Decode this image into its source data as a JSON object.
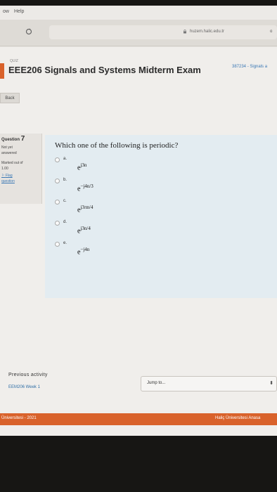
{
  "menubar": {
    "items": [
      "ow",
      "Help"
    ]
  },
  "browser": {
    "url": "huzem.halic.edu.tr"
  },
  "header": {
    "breadcrumb": "QUIZ",
    "title": "EEE206 Signals and Systems Midterm Exam",
    "course_code": "387234 - Signals a",
    "back_label": "Back"
  },
  "question_info": {
    "label": "Question",
    "number": "7",
    "state_line1": "Not yet",
    "state_line2": "answered",
    "marked_line1": "Marked out of",
    "marked_line2": "1.00",
    "flag_line1": "Flag",
    "flag_line2": "question"
  },
  "question": {
    "text": "Which one of the following is periodic?",
    "options": [
      {
        "letter": "a.",
        "base": "e",
        "exp": "j3n"
      },
      {
        "letter": "b.",
        "base": "e",
        "exp": "−j4n/3"
      },
      {
        "letter": "c.",
        "base": "e",
        "exp": "j3πn/4"
      },
      {
        "letter": "d.",
        "base": "e",
        "exp": "j3n/4"
      },
      {
        "letter": "e.",
        "base": "e",
        "exp": "−j4n"
      }
    ]
  },
  "navigation": {
    "previous_label": "Previous activity",
    "previous_link": "EEM206 Week 1",
    "jump_label": "Jump to..."
  },
  "footer": {
    "left": "Üniversitesi - 2021",
    "right": "Haliç Üniversitesi Anasa"
  },
  "colors": {
    "accent": "#d9622b",
    "link": "#2f6ea6",
    "question_bg": "#e3ecf1"
  }
}
